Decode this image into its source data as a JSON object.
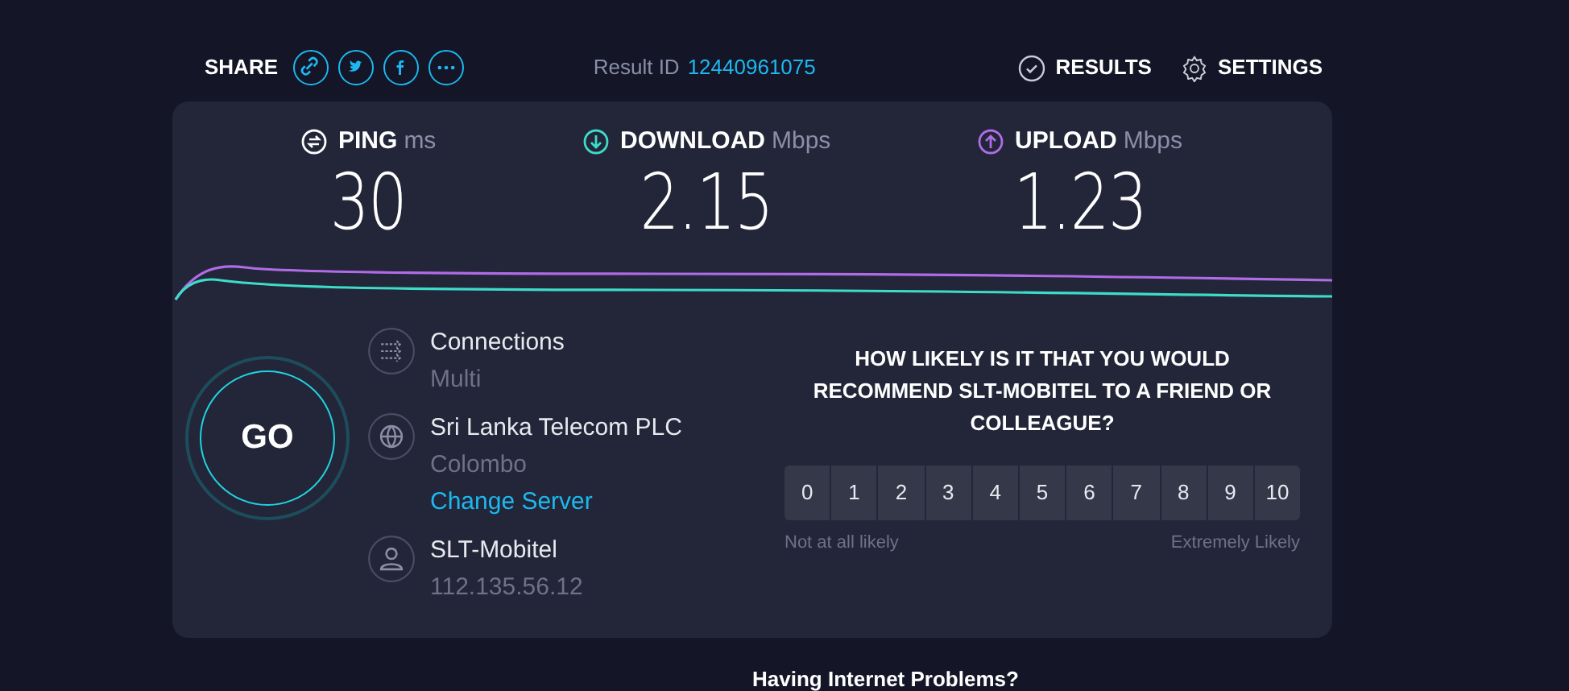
{
  "header": {
    "share_label": "SHARE",
    "share_buttons": [
      {
        "kind": "link"
      },
      {
        "kind": "twitter"
      },
      {
        "kind": "facebook"
      },
      {
        "kind": "more"
      }
    ],
    "result_label": "Result ID",
    "result_id": "12440961075",
    "nav": [
      {
        "kind": "results",
        "label": "RESULTS"
      },
      {
        "kind": "settings",
        "label": "SETTINGS"
      }
    ]
  },
  "metrics": [
    {
      "kind": "ping",
      "label": "PING",
      "unit": "ms",
      "value": "30"
    },
    {
      "kind": "download",
      "label": "DOWNLOAD",
      "unit": "Mbps",
      "value": "2.15"
    },
    {
      "kind": "upload",
      "label": "UPLOAD",
      "unit": "Mbps",
      "value": "1.23"
    }
  ],
  "go_button": "GO",
  "info": [
    {
      "kind": "connections",
      "title": "Connections",
      "detail": "Multi"
    },
    {
      "kind": "server",
      "title": "Sri Lanka Telecom PLC",
      "detail": "Colombo",
      "link": "Change Server"
    },
    {
      "kind": "provider",
      "title": "SLT-Mobitel",
      "detail": "112.135.56.12"
    }
  ],
  "survey": {
    "question": "HOW LIKELY IS IT THAT YOU WOULD RECOMMEND SLT-MOBITEL TO A FRIEND OR COLLEAGUE?",
    "scale": [
      "0",
      "1",
      "2",
      "3",
      "4",
      "5",
      "6",
      "7",
      "8",
      "9",
      "10"
    ],
    "low_label": "Not at all likely",
    "high_label": "Extremely Likely"
  },
  "footer_heading": "Having Internet Problems?"
}
